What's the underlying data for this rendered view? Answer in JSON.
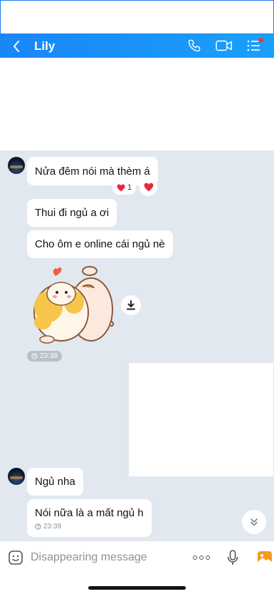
{
  "header": {
    "title": "Lily",
    "icons": [
      "back-arrow-icon",
      "phone-icon",
      "video-call-icon",
      "menu-list-icon"
    ],
    "color": "#1a8ff8"
  },
  "messages": [
    {
      "id": "m1",
      "text": "Nửa đêm nói mà thèm á",
      "reaction_count": "1"
    },
    {
      "id": "m2",
      "text": "Thui đi ngủ a ơi"
    },
    {
      "id": "m3",
      "text": "Cho ôm e online cái ngủ nè"
    },
    {
      "id": "m4",
      "type": "sticker",
      "time": "23:38"
    },
    {
      "id": "m5",
      "text": "Ngủ nha"
    },
    {
      "id": "m6",
      "text": "Nói nữa là a mất ngủ h",
      "time": "23:39"
    }
  ],
  "composer": {
    "placeholder": "Disappearing message",
    "more_label": "ooo"
  },
  "colors": {
    "chat_bg": "#e1e8f0",
    "heart": "#e8283c",
    "accent": "#1a8ff8"
  }
}
